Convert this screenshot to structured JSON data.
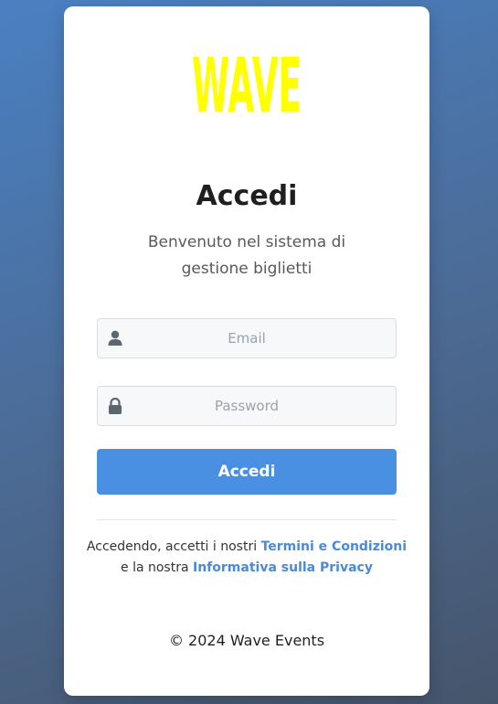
{
  "logo": {
    "text": "WAVE",
    "color": "#ffff00"
  },
  "login": {
    "title": "Accedi",
    "subtitle": "Benvenuto nel sistema di gestione biglietti",
    "email_placeholder": "Email",
    "password_placeholder": "Password",
    "submit_label": "Accedi"
  },
  "terms": {
    "prefix": "Accedendo, accetti i nostri ",
    "terms_link": "Termini e Condizioni",
    "middle": " e la nostra ",
    "privacy_link": "Informativa sulla Privacy"
  },
  "footer": {
    "copyright": "© 2024 Wave Events"
  },
  "colors": {
    "accent": "#4a90e2",
    "link": "#4a8ad6",
    "logo": "#ffff00"
  },
  "icons": {
    "email": "user-icon",
    "password": "lock-icon"
  }
}
